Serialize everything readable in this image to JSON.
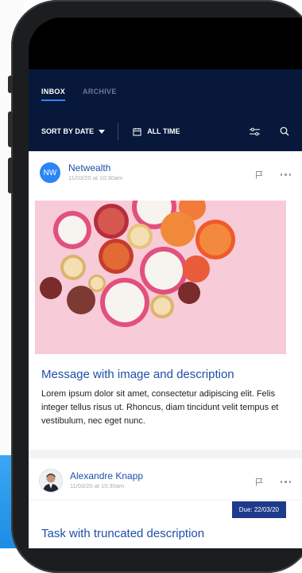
{
  "tabs": [
    {
      "label": "INBOX",
      "active": true
    },
    {
      "label": "ARCHIVE",
      "active": false
    }
  ],
  "filters": {
    "sort_label": "SORT BY DATE",
    "range_label": "ALL TIME"
  },
  "messages": [
    {
      "avatar_initials": "NW",
      "sender": "Netwealth",
      "time": "11/03/20 at 10:30am",
      "title": "Message with image and description",
      "body": "Lorem ipsum dolor sit amet, consectetur adipiscing elit. Felis integer tellus risus ut. Rhoncus, diam tincidunt velit tempus et vestibulum, nec eget nunc."
    },
    {
      "sender": "Alexandre Knapp",
      "time": "11/03/20 at 10:30am",
      "due": "Due: 22/03/20",
      "title": "Task with truncated description"
    }
  ],
  "colors": {
    "header_bg": "#07183b",
    "accent": "#2f86ff",
    "link": "#1f4fa8",
    "due_badge": "#1e3a8a"
  }
}
